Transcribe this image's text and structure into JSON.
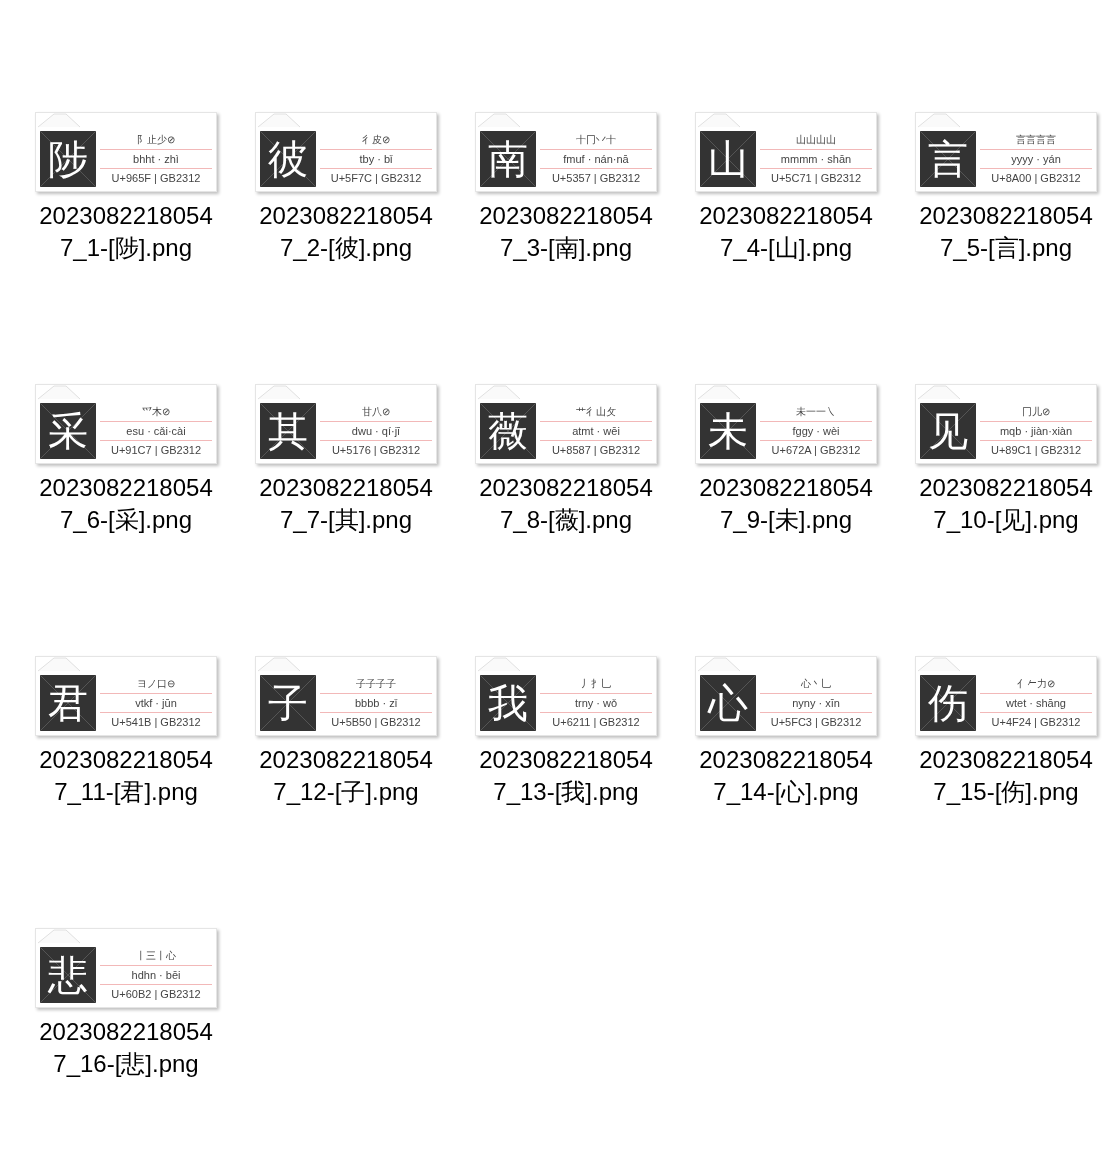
{
  "files": [
    {
      "glyph": "陟",
      "components": "阝止少⊘",
      "code": "bhht · zhì",
      "unicode": "U+965F | GB2312",
      "filename": "20230822180547_1-[陟].png"
    },
    {
      "glyph": "彼",
      "components": "彳皮⊘",
      "code": "tby · bǐ",
      "unicode": "U+5F7C | GB2312",
      "filename": "20230822180547_2-[彼].png"
    },
    {
      "glyph": "南",
      "components": "十冂丷十",
      "code": "fmuf · nán·nā",
      "unicode": "U+5357 | GB2312",
      "filename": "20230822180547_3-[南].png"
    },
    {
      "glyph": "山",
      "components": "山山山山",
      "code": "mmmm · shān",
      "unicode": "U+5C71 | GB2312",
      "filename": "20230822180547_4-[山].png"
    },
    {
      "glyph": "言",
      "components": "言言言言",
      "code": "yyyy · yán",
      "unicode": "U+8A00 | GB2312",
      "filename": "20230822180547_5-[言].png"
    },
    {
      "glyph": "采",
      "components": "爫木⊘",
      "code": "esu · cǎi·cài",
      "unicode": "U+91C7 | GB2312",
      "filename": "20230822180547_6-[采].png"
    },
    {
      "glyph": "其",
      "components": "甘八⊘",
      "code": "dwu · qí·jī",
      "unicode": "U+5176 | GB2312",
      "filename": "20230822180547_7-[其].png"
    },
    {
      "glyph": "薇",
      "components": "艹彳山攵",
      "code": "atmt · wēi",
      "unicode": "U+8587 | GB2312",
      "filename": "20230822180547_8-[薇].png"
    },
    {
      "glyph": "未",
      "components": "未一一㇏",
      "code": "fggy · wèi",
      "unicode": "U+672A | GB2312",
      "filename": "20230822180547_9-[未].png"
    },
    {
      "glyph": "见",
      "components": "冂儿⊘",
      "code": "mqb · jiàn·xiàn",
      "unicode": "U+89C1 | GB2312",
      "filename": "20230822180547_10-[见].png"
    },
    {
      "glyph": "君",
      "components": "ヨノ口⊖",
      "code": "vtkf · jūn",
      "unicode": "U+541B | GB2312",
      "filename": "20230822180547_11-[君].png"
    },
    {
      "glyph": "子",
      "components": "子子子子",
      "code": "bbbb · zǐ",
      "unicode": "U+5B50 | GB2312",
      "filename": "20230822180547_12-[子].png"
    },
    {
      "glyph": "我",
      "components": "丿扌乚",
      "code": "trny · wǒ",
      "unicode": "U+6211 | GB2312",
      "filename": "20230822180547_13-[我].png"
    },
    {
      "glyph": "心",
      "components": "心丶乚",
      "code": "nyny · xīn",
      "unicode": "U+5FC3 | GB2312",
      "filename": "20230822180547_14-[心].png"
    },
    {
      "glyph": "伤",
      "components": "亻𠂉力⊘",
      "code": "wtet · shāng",
      "unicode": "U+4F24 | GB2312",
      "filename": "20230822180547_15-[伤].png"
    },
    {
      "glyph": "悲",
      "components": "丨三丨心",
      "code": "hdhn · bēi",
      "unicode": "U+60B2 | GB2312",
      "filename": "20230822180547_16-[悲].png"
    }
  ]
}
